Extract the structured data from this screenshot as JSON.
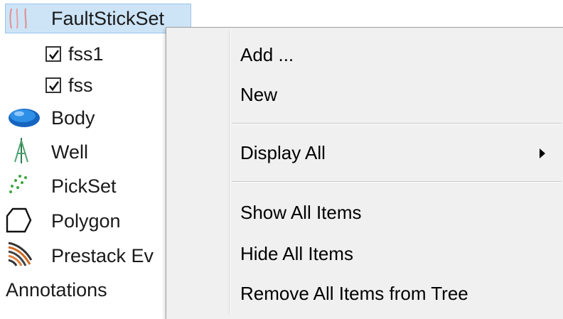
{
  "tree": {
    "items": [
      {
        "label": "FaultStickSet",
        "icon": "fault-stick-set-icon",
        "selected": true
      },
      {
        "label": "fss1",
        "checked": true
      },
      {
        "label": "fss",
        "checked": true
      },
      {
        "label": "Body",
        "icon": "body-icon"
      },
      {
        "label": "Well",
        "icon": "well-icon"
      },
      {
        "label": "PickSet",
        "icon": "pickset-icon"
      },
      {
        "label": "Polygon",
        "icon": "polygon-icon"
      },
      {
        "label": "Prestack Ev",
        "icon": "prestack-events-icon"
      },
      {
        "label": "Annotations"
      }
    ]
  },
  "menu": {
    "items": [
      {
        "label": "Add ..."
      },
      {
        "label": "New"
      },
      {
        "label": "Display All",
        "submenu": true
      },
      {
        "label": "Show All Items"
      },
      {
        "label": "Hide All Items"
      },
      {
        "label": "Remove All Items from Tree"
      }
    ]
  },
  "colors": {
    "selection": "#cde4f7",
    "menu_bg": "#f0f0f0",
    "body_icon": "#1e7fd8",
    "well_icon": "#2e8b57",
    "pickset_icon": "#3aa63a"
  }
}
